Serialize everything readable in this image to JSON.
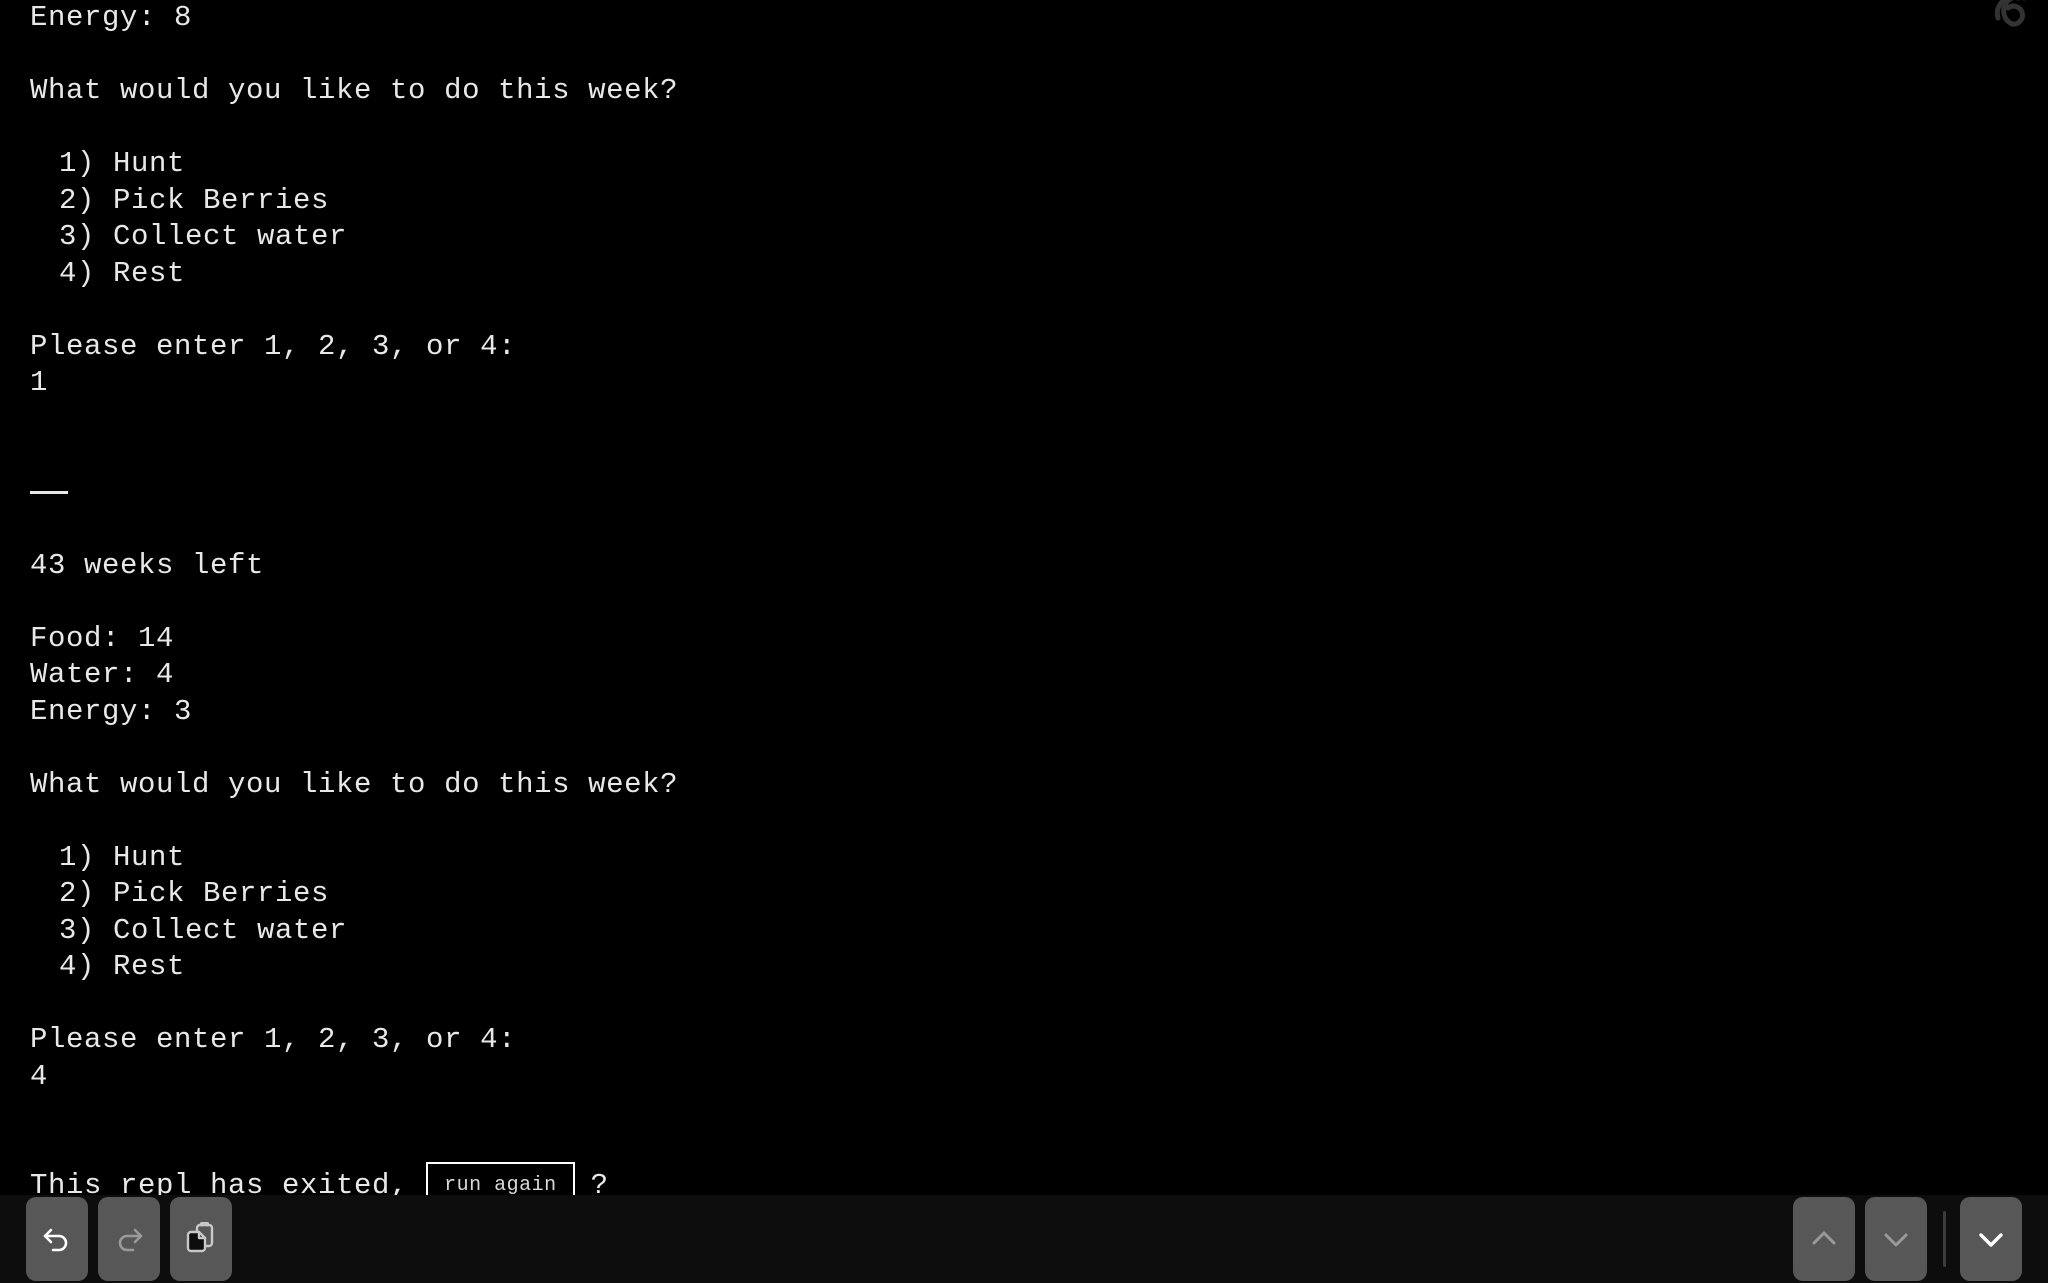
{
  "app": {
    "name": "replit-console",
    "watermark_icon": "spiral-logo-icon",
    "background_color": "#000000",
    "text_color": "#e8e8e8",
    "toolbar_color": "#0d0d0d",
    "button_color": "#575757"
  },
  "console": {
    "blocks": [
      {
        "type": "stats",
        "lines": [
          "Energy: 8"
        ]
      },
      {
        "type": "prompt",
        "question": "What would you like to do this week?",
        "options": [
          "1) Hunt",
          "2) Pick Berries",
          "3) Collect water",
          "4) Rest"
        ],
        "enter_prompt": "Please enter 1, 2, 3, or 4:",
        "user_input": "1"
      },
      {
        "type": "separator",
        "glyph": "——"
      },
      {
        "type": "status",
        "weeks_left_line": "43 weeks left",
        "stats": [
          "Food: 14",
          "Water: 4",
          "Energy: 3"
        ]
      },
      {
        "type": "prompt",
        "question": "What would you like to do this week?",
        "options": [
          "1) Hunt",
          "2) Pick Berries",
          "3) Collect water",
          "4) Rest"
        ],
        "enter_prompt": "Please enter 1, 2, 3, or 4:",
        "user_input": "4"
      }
    ],
    "exit_message": {
      "prefix": "This repl has exited,",
      "button_label": "run again",
      "suffix": "?"
    }
  },
  "toolbar": {
    "left_buttons": [
      {
        "name": "undo-button",
        "icon": "undo-arrow-icon",
        "state": "enabled"
      },
      {
        "name": "redo-button",
        "icon": "redo-arrow-icon",
        "state": "disabled"
      },
      {
        "name": "paste-button",
        "icon": "clipboard-paste-icon",
        "state": "enabled"
      }
    ],
    "right_buttons": [
      {
        "name": "scroll-up-button",
        "icon": "chevron-up-icon",
        "state": "disabled"
      },
      {
        "name": "scroll-down-button",
        "icon": "chevron-down-icon",
        "state": "disabled"
      },
      {
        "name": "dismiss-keyboard-button",
        "icon": "chevron-down-icon",
        "state": "enabled"
      }
    ]
  }
}
